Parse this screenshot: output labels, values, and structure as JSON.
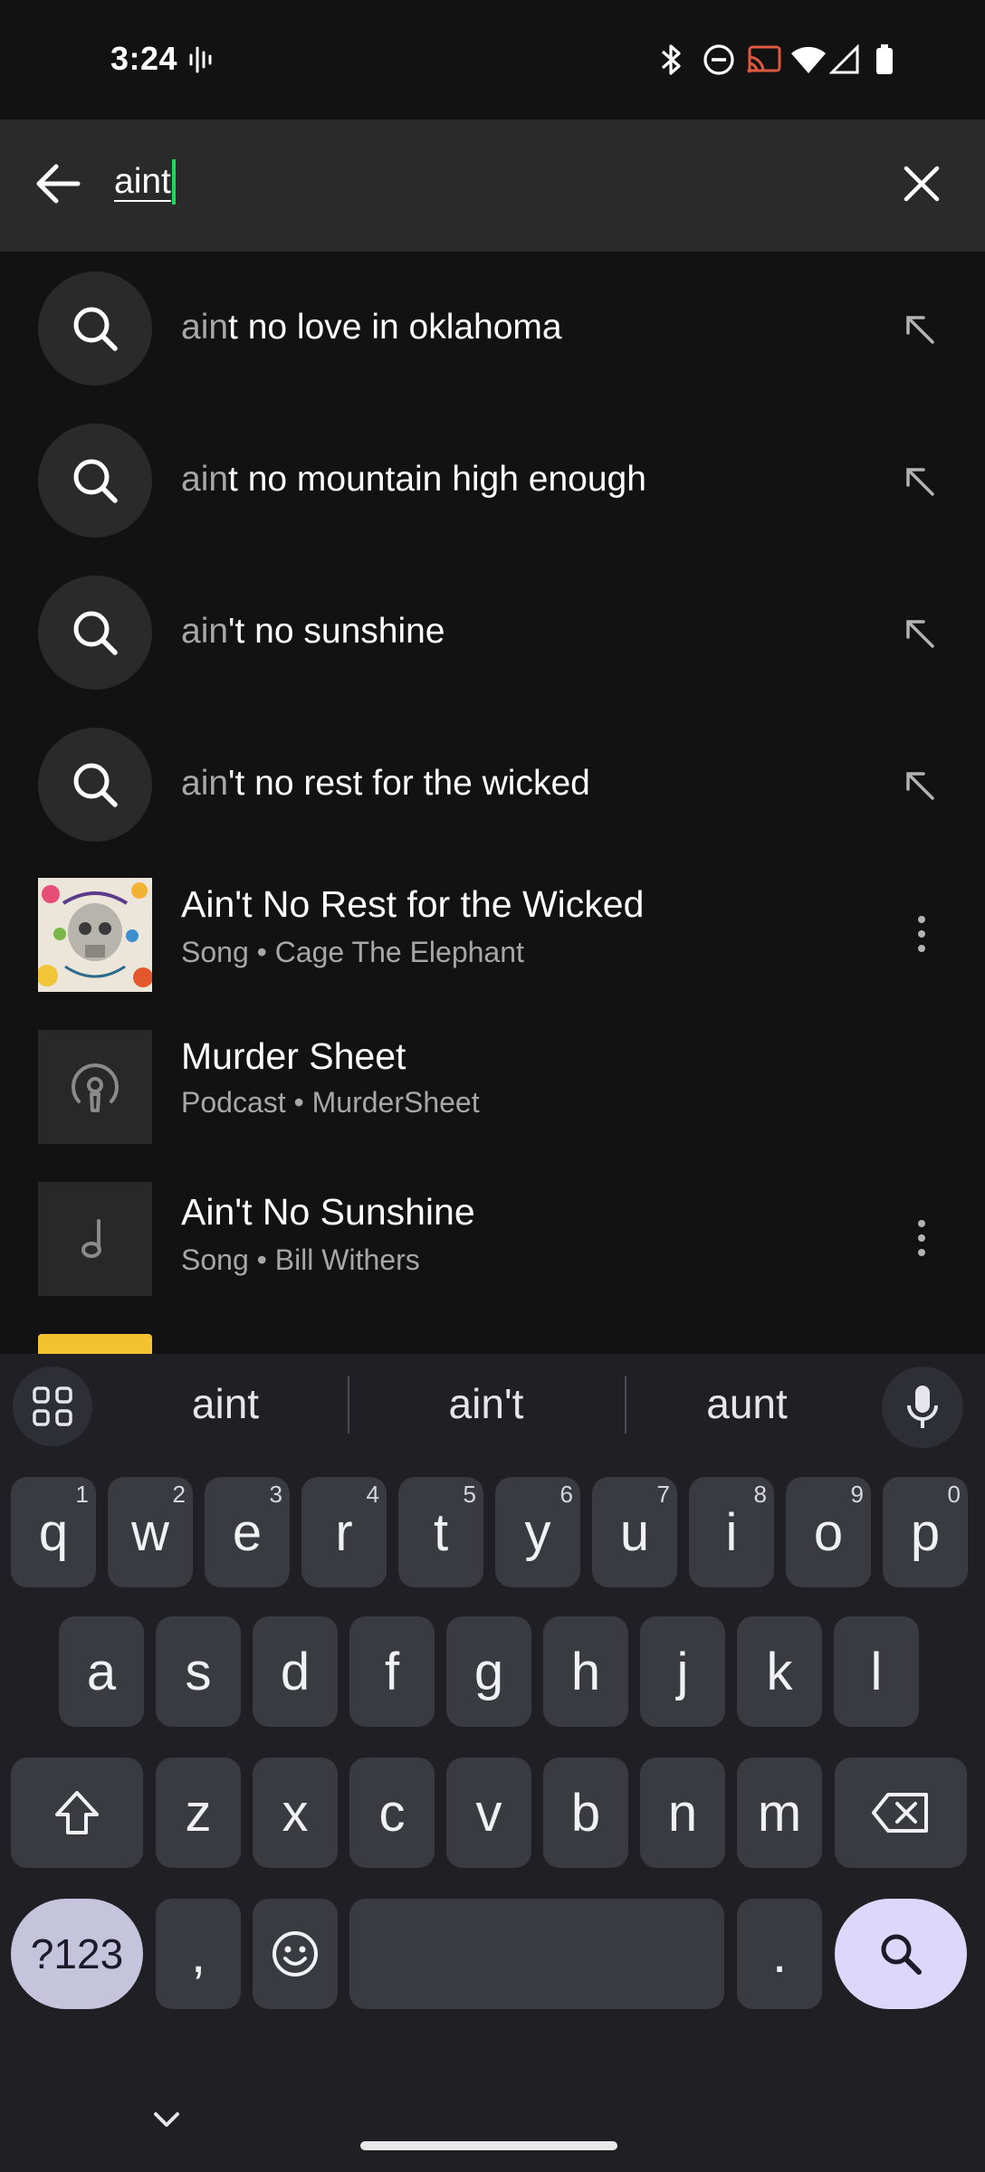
{
  "status_bar": {
    "time": "3:24",
    "icons": [
      "sound-wave-icon",
      "bluetooth-icon",
      "do-not-disturb-icon",
      "cast-icon",
      "wifi-icon",
      "signal-icon",
      "battery-icon"
    ]
  },
  "search": {
    "query": "aint",
    "back_icon": "arrow-left-icon",
    "clear_icon": "close-icon"
  },
  "suggestions": [
    {
      "match": "ain",
      "rest": "t no love in oklahoma"
    },
    {
      "match": "ain",
      "rest": "t no mountain high enough"
    },
    {
      "match": "ain",
      "rest": "'t no sunshine"
    },
    {
      "match": "ain",
      "rest": "'t no rest for the wicked"
    }
  ],
  "results": [
    {
      "title": "Ain't No Rest for the Wicked",
      "subtitle": "Song • Cage The Elephant",
      "thumb": "album-art",
      "has_menu": true
    },
    {
      "title": "Murder Sheet",
      "subtitle": "Podcast • MurderSheet",
      "thumb": "podcast-icon",
      "has_menu": false
    },
    {
      "title": "Ain't No Sunshine",
      "subtitle": "Song • Bill Withers",
      "thumb": "music-note-icon",
      "has_menu": true
    }
  ],
  "keyboard": {
    "suggestions": [
      "aint",
      "ain't",
      "aunt"
    ],
    "row1": [
      {
        "k": "q",
        "n": "1"
      },
      {
        "k": "w",
        "n": "2"
      },
      {
        "k": "e",
        "n": "3"
      },
      {
        "k": "r",
        "n": "4"
      },
      {
        "k": "t",
        "n": "5"
      },
      {
        "k": "y",
        "n": "6"
      },
      {
        "k": "u",
        "n": "7"
      },
      {
        "k": "i",
        "n": "8"
      },
      {
        "k": "o",
        "n": "9"
      },
      {
        "k": "p",
        "n": "0"
      }
    ],
    "row2": [
      "a",
      "s",
      "d",
      "f",
      "g",
      "h",
      "j",
      "k",
      "l"
    ],
    "row3": [
      "z",
      "x",
      "c",
      "v",
      "b",
      "n",
      "m"
    ],
    "symbols_label": "?123",
    "comma": ",",
    "period": "."
  },
  "colors": {
    "background": "#121212",
    "search_bar": "#2a2a2a",
    "caret": "#1ed760",
    "muted_text": "#a7a7a7",
    "keyboard_bg": "#1f1f24",
    "key": "#3a3b40",
    "enter_key": "#ddd8fb"
  }
}
